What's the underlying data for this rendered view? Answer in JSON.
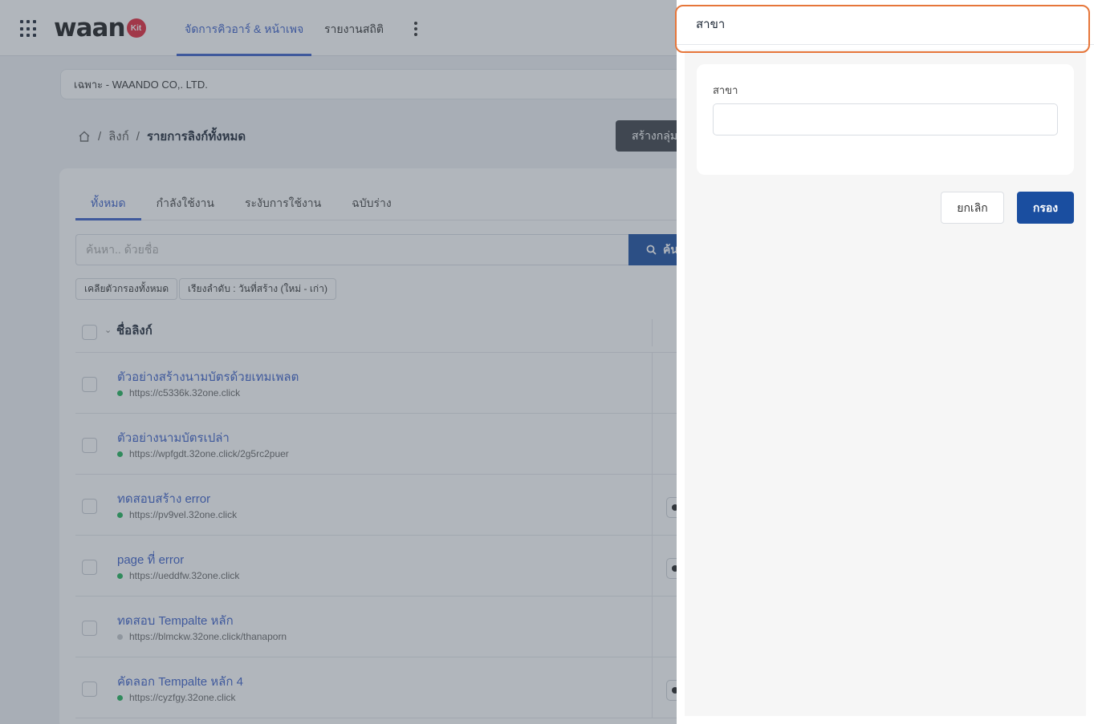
{
  "app": {
    "logo_text": "waan",
    "logo_badge": "Kit",
    "nav_tabs": [
      {
        "label": "จัดการคิวอาร์ & หน้าเพจ",
        "active": true
      },
      {
        "label": "รายงานสถิติ",
        "active": false
      }
    ],
    "company": "เฉพาะ - WAANDO CO,. LTD.",
    "breadcrumb": [
      "ลิงก์",
      "รายการลิงก์ทั้งหมด"
    ],
    "create_group_label": "สร้างกลุ่ม"
  },
  "list": {
    "tabs": [
      {
        "label": "ทั้งหมด",
        "active": true
      },
      {
        "label": "กำลังใช้งาน",
        "active": false
      },
      {
        "label": "ระงับการใช้งาน",
        "active": false
      },
      {
        "label": "ฉบับร่าง",
        "active": false
      }
    ],
    "search_placeholder": "ค้นหา.. ด้วยชื่อ",
    "search_button": "ค้น",
    "chips": [
      "เคลียตัวกรองทั้งหมด",
      "เรียงลำดับ : วันที่สร้าง (ใหม่ - เก่า)"
    ],
    "column_name": "ชื่อลิงก์",
    "rows": [
      {
        "title": "ตัวอย่างสร้างนามบัตรด้วยเทมเพลต",
        "url": "https://c5336k.32one.click",
        "status": "active",
        "toggle": false
      },
      {
        "title": "ตัวอย่างนามบัตรเปล่า",
        "url": "https://wpfgdt.32one.click/2g5rc2puer",
        "status": "active",
        "toggle": false
      },
      {
        "title": "ทดสอบสร้าง error",
        "url": "https://pv9vel.32one.click",
        "status": "active",
        "toggle": true
      },
      {
        "title": "page ที่ error",
        "url": "https://ueddfw.32one.click",
        "status": "active",
        "toggle": true
      },
      {
        "title": "ทดสอบ Tempalte หลัก",
        "url": "https://blmckw.32one.click/thanaporn",
        "status": "inactive",
        "toggle": false
      },
      {
        "title": "คัดลอก Tempalte หลัก 4",
        "url": "https://cyzfgy.32one.click",
        "status": "active",
        "toggle": true
      }
    ]
  },
  "drawer": {
    "title": "สาขา",
    "field_label": "สาขา",
    "field_value": "",
    "cancel_label": "ยกเลิก",
    "filter_label": "กรอง"
  },
  "colors": {
    "primary": "#1a4ea0",
    "link": "#3b5fc9",
    "highlight": "#e6763a",
    "status_active": "#22b35a"
  }
}
